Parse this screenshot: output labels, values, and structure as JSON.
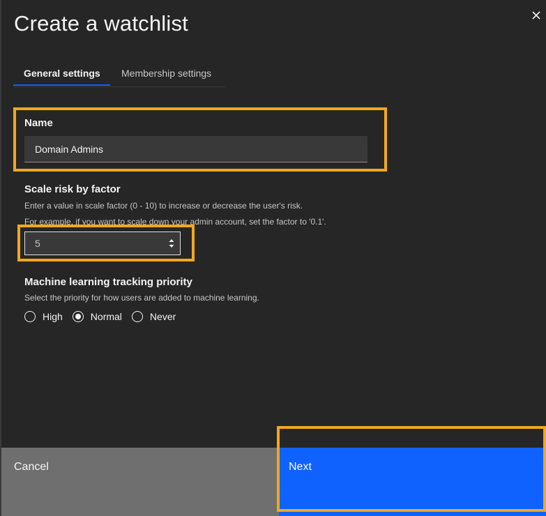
{
  "modal": {
    "title": "Create a watchlist",
    "close_icon": "close-icon"
  },
  "tabs": [
    {
      "label": "General settings",
      "selected": true
    },
    {
      "label": "Membership settings",
      "selected": false
    }
  ],
  "name_field": {
    "label": "Name",
    "value": "Domain Admins"
  },
  "scale_field": {
    "label": "Scale risk by factor",
    "helper1": "Enter a value in scale factor (0 - 10) to increase or decrease the user's risk.",
    "helper2": "For example, if you want to scale down your admin account, set the factor to '0.1'.",
    "value": "5",
    "spinner_icon": "spinner-arrows-icon"
  },
  "ml_priority": {
    "label": "Machine learning tracking priority",
    "helper": "Select the priority for how users are added to machine learning.",
    "options": [
      {
        "label": "High",
        "checked": false
      },
      {
        "label": "Normal",
        "checked": true
      },
      {
        "label": "Never",
        "checked": false
      }
    ]
  },
  "footer": {
    "cancel_label": "Cancel",
    "next_label": "Next"
  },
  "colors": {
    "background": "#262626",
    "primary": "#0f62fe",
    "highlight": "#f1a81c",
    "secondary_button": "#6f6f6f"
  }
}
